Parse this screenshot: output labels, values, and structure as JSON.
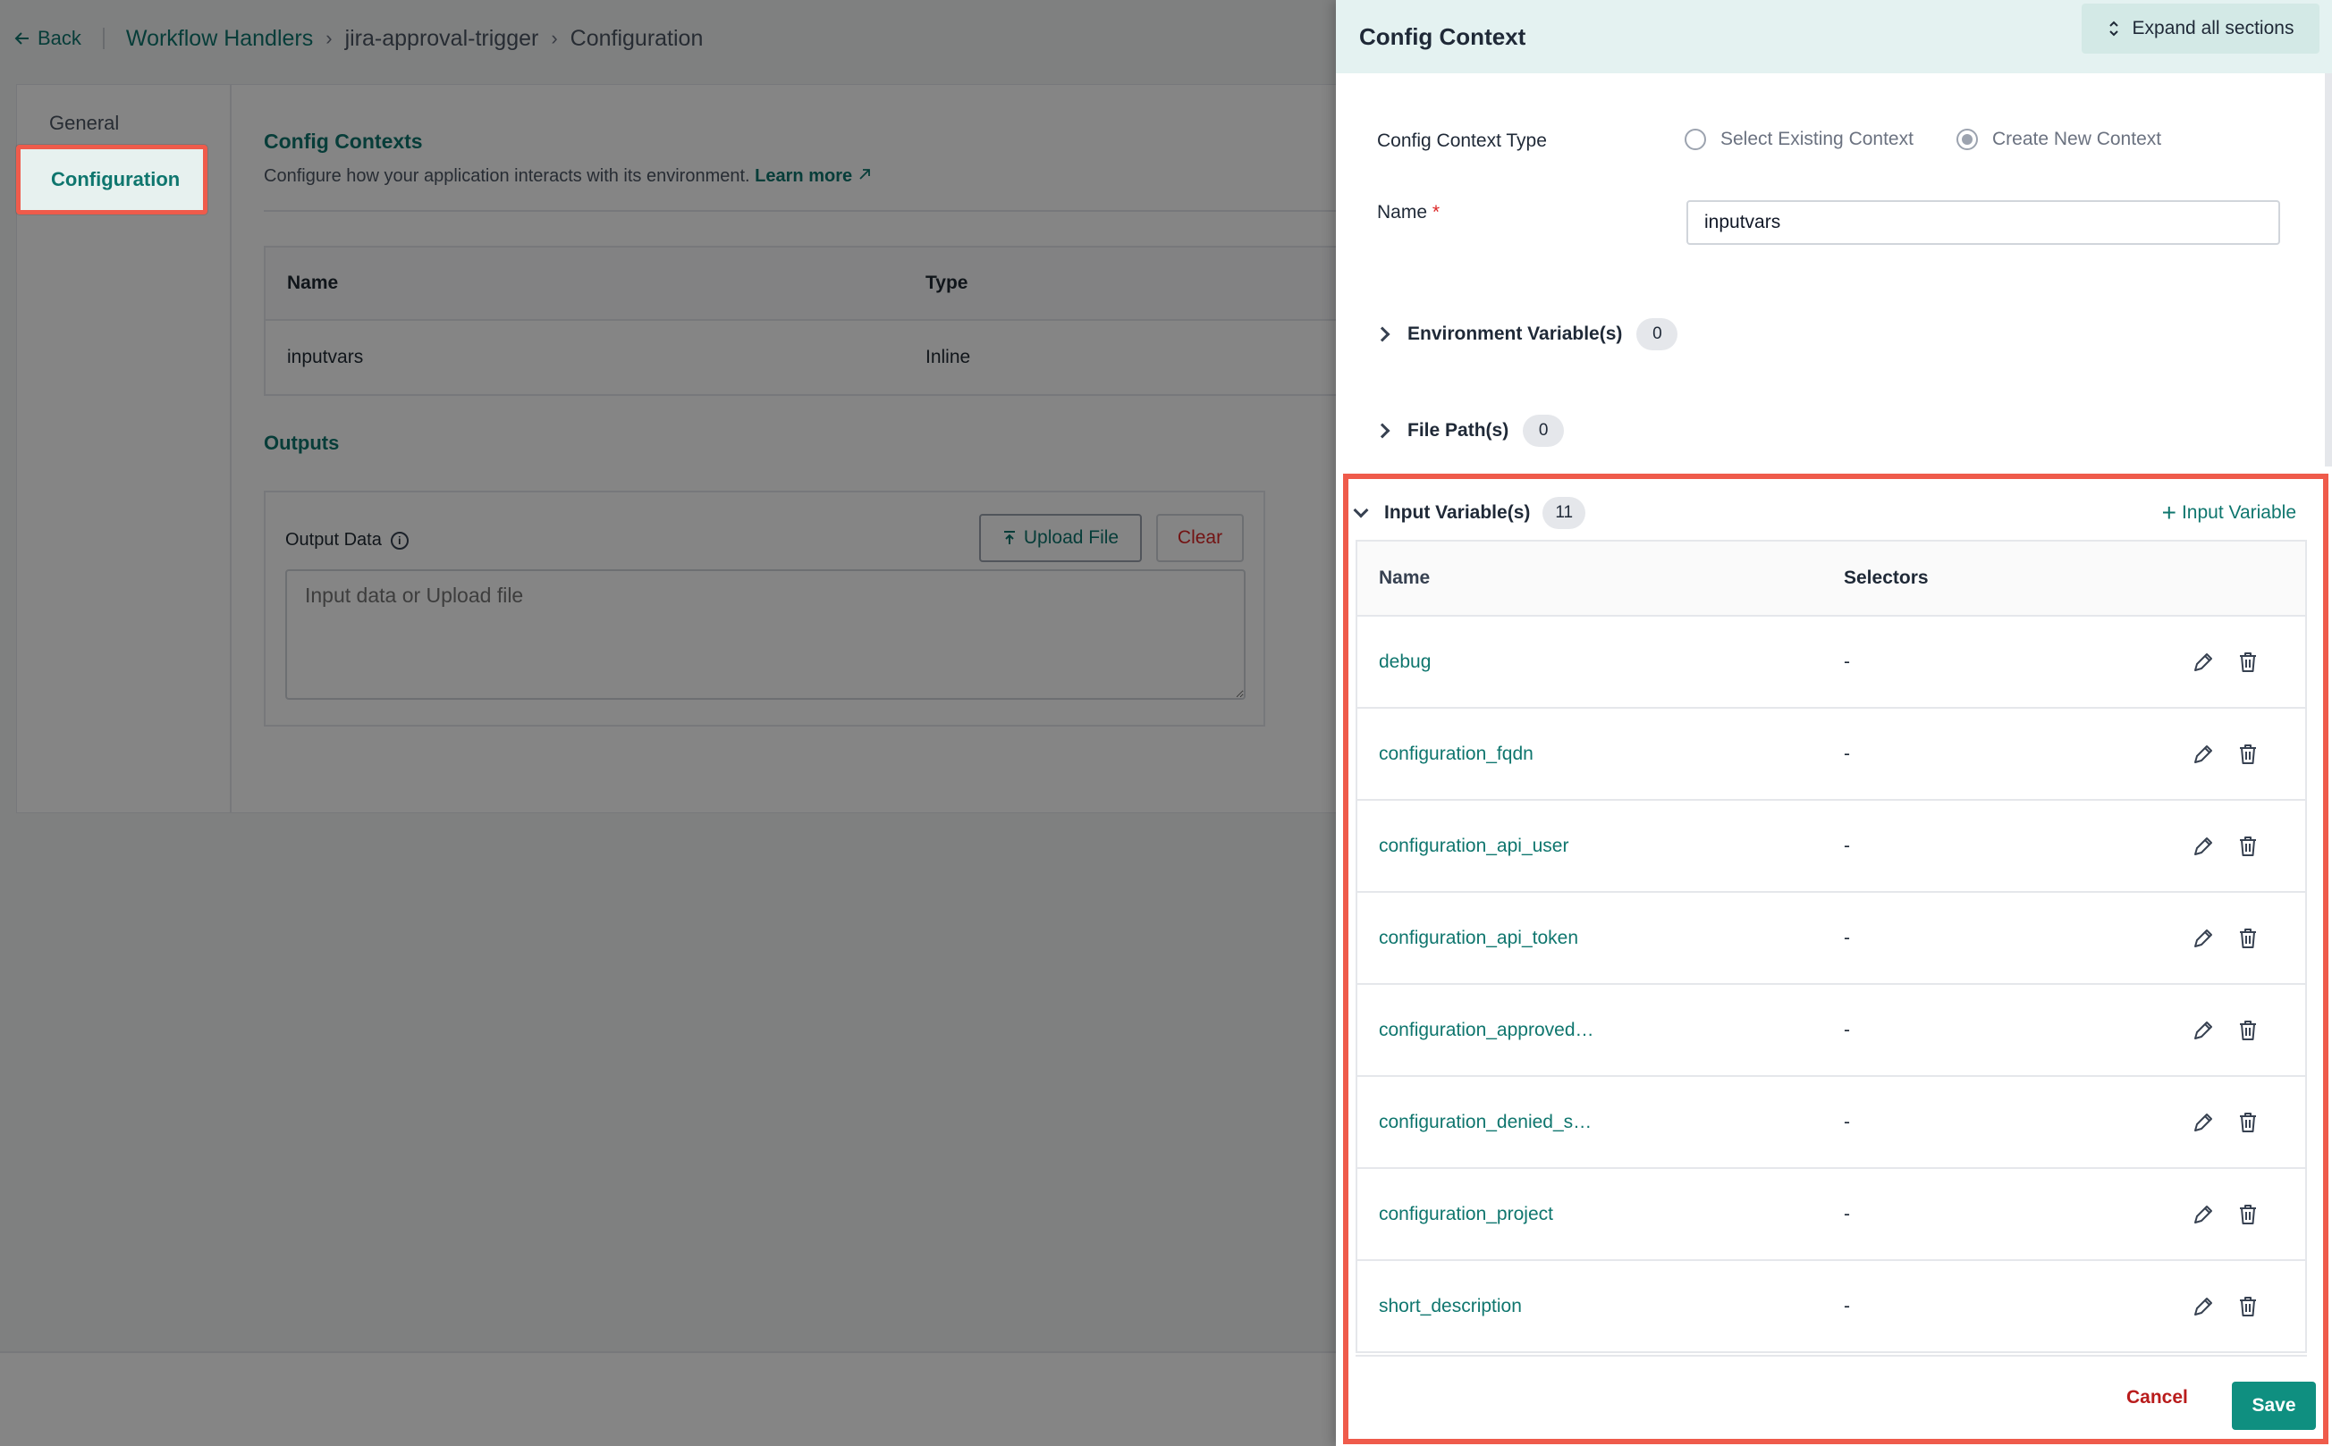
{
  "breadcrumb": {
    "back": "Back",
    "items": [
      "Workflow Handlers",
      "jira-approval-trigger",
      "Configuration"
    ]
  },
  "sidebar": {
    "items": [
      {
        "label": "General"
      },
      {
        "label": "Configuration",
        "active": true
      }
    ]
  },
  "main": {
    "config_contexts": {
      "title": "Config Contexts",
      "subtitle": "Configure how your application interacts with its environment.",
      "learn_more": "Learn more",
      "columns": [
        "Name",
        "Type"
      ],
      "rows": [
        [
          "inputvars",
          "Inline"
        ]
      ]
    },
    "outputs": {
      "title": "Outputs",
      "label": "Output Data",
      "upload_label": "Upload File",
      "clear_label": "Clear",
      "placeholder": "Input data or Upload file"
    }
  },
  "drawer": {
    "title": "Config Context",
    "expand_label": "Expand all sections",
    "type_label": "Config Context Type",
    "type_options": [
      "Select Existing Context",
      "Create New Context"
    ],
    "selected_type": "Create New Context",
    "name_label": "Name",
    "name_required": "*",
    "name_value": "inputvars",
    "sections": [
      {
        "label": "Environment Variable(s)",
        "count": "0"
      },
      {
        "label": "File Path(s)",
        "count": "0"
      }
    ],
    "input_variables": {
      "label": "Input Variable(s)",
      "count": "11",
      "add_label": "Input Variable",
      "columns": [
        "Name",
        "Selectors"
      ],
      "rows": [
        {
          "name": "debug",
          "selectors": "-"
        },
        {
          "name": "configuration_fqdn",
          "selectors": "-"
        },
        {
          "name": "configuration_api_user",
          "selectors": "-"
        },
        {
          "name": "configuration_api_token",
          "selectors": "-"
        },
        {
          "name": "configuration_approved…",
          "selectors": "-"
        },
        {
          "name": "configuration_denied_s…",
          "selectors": "-"
        },
        {
          "name": "configuration_project",
          "selectors": "-"
        },
        {
          "name": "short_description",
          "selectors": "-"
        }
      ]
    },
    "cancel_label": "Cancel",
    "save_label": "Save"
  },
  "colors": {
    "accent": "#0f766e",
    "highlight": "#ef5b4b",
    "danger": "#dc2626",
    "save": "#0f8f80"
  }
}
